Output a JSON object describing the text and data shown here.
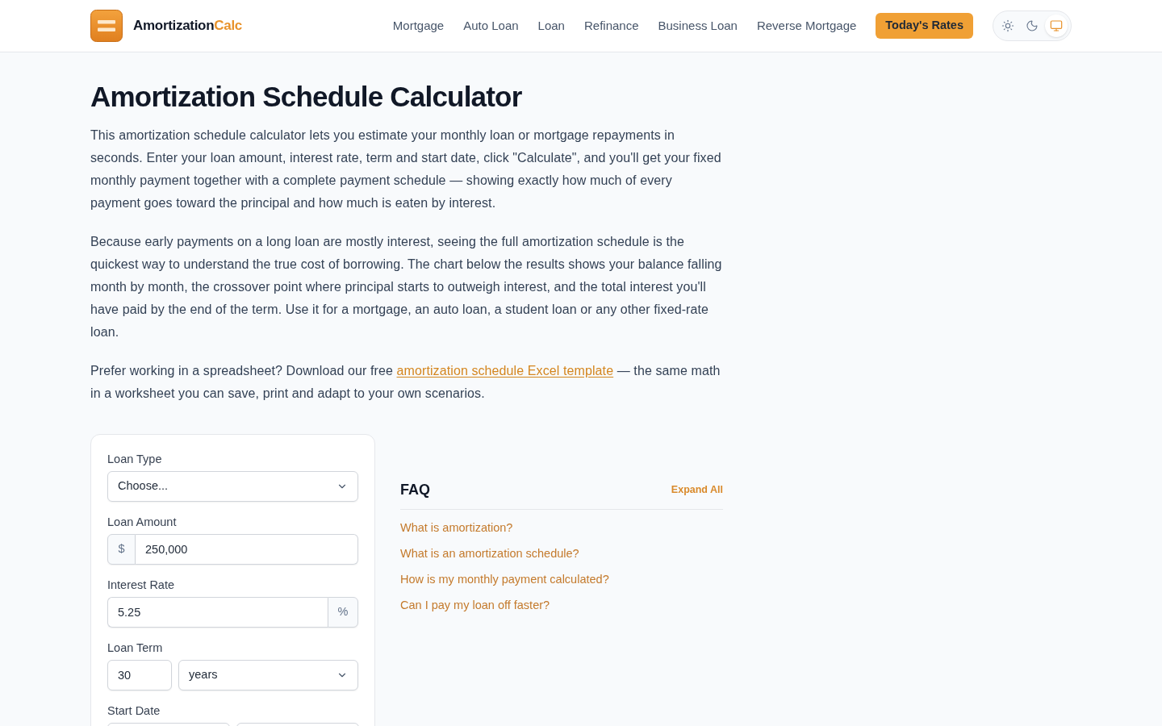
{
  "header": {
    "brand": {
      "name": "Amortization",
      "accent": "Calc"
    },
    "nav": [
      "Mortgage",
      "Auto Loan",
      "Loan",
      "Refinance",
      "Business Loan",
      "Reverse Mortgage"
    ],
    "cta": "Today's Rates",
    "theme_options": [
      {
        "kind": "light",
        "selected": false
      },
      {
        "kind": "dark",
        "selected": false
      },
      {
        "kind": "system",
        "selected": true
      }
    ]
  },
  "intro": {
    "title": "Amortization Schedule Calculator",
    "paragraphs": [
      {
        "text": "This amortization schedule calculator lets you estimate your monthly loan or mortgage repayments in seconds. Enter your loan amount, interest rate, term and start date, click \"Calculate\", and you'll get your fixed monthly payment together with a complete payment schedule — showing exactly how much of every payment goes toward the principal and how much is eaten by interest."
      },
      {
        "text": "Because early payments on a long loan are mostly interest, seeing the full amortization schedule is the quickest way to understand the true cost of borrowing. The chart below the results shows your balance falling month by month, the crossover point where principal starts to outweigh interest, and the total interest you'll have paid by the end of the term. Use it for a mortgage, an auto loan, a student loan or any other fixed-rate loan."
      },
      {
        "text": "Prefer working in a spreadsheet? Download our free",
        "link": "amortization schedule Excel template",
        "after": "— the same math in a worksheet you can save, print and adapt to your own scenarios."
      }
    ]
  },
  "calculator": {
    "fields": [
      {
        "kind": "select",
        "label": "Loan Type",
        "value": "Choose..."
      },
      {
        "kind": "prefixed",
        "label": "Loan Amount",
        "prefix": "$",
        "value": "250,000"
      },
      {
        "kind": "suffixed",
        "label": "Interest Rate",
        "value": "5.25",
        "suffix": "%"
      },
      {
        "kind": "number_unit",
        "label": "Loan Term",
        "value": "30",
        "unit": "years"
      },
      {
        "kind": "pair",
        "label": "Start Date"
      }
    ]
  },
  "faq": {
    "title": "FAQ",
    "expand_all": "Expand All",
    "questions": [
      "What is amortization?",
      "What is an amortization schedule?",
      "How is my monthly payment calculated?",
      "Can I pay my loan off faster?"
    ]
  }
}
